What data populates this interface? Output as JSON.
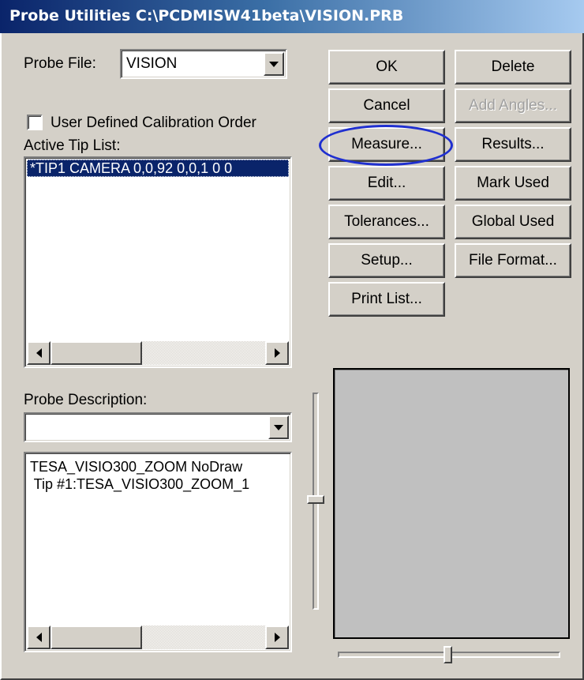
{
  "window": {
    "title": "Probe Utilities  C:\\PCDMISW41beta\\VISION.PRB"
  },
  "probe_file": {
    "label": "Probe File:",
    "value": "VISION"
  },
  "calibration": {
    "checkbox_label": "User Defined Calibration Order",
    "checked": false
  },
  "active_tip_list": {
    "label": "Active Tip List:",
    "items": [
      "*TIP1 CAMERA 0,0,92  0,0,1  0  0"
    ]
  },
  "probe_description": {
    "label": "Probe Description:",
    "value": "",
    "lines": [
      "TESA_VISIO300_ZOOM  NoDraw",
      " Tip #1:TESA_VISIO300_ZOOM_1"
    ]
  },
  "buttons": {
    "ok": "OK",
    "delete": "Delete",
    "cancel": "Cancel",
    "add_angles": "Add Angles...",
    "measure": "Measure...",
    "results": "Results...",
    "edit": "Edit...",
    "mark_used": "Mark Used",
    "tolerances": "Tolerances...",
    "global_used": "Global Used",
    "setup": "Setup...",
    "file_format": "File Format...",
    "print_list": "Print List..."
  },
  "sliders": {
    "vertical_position": 0.49,
    "horizontal_position": 0.5
  },
  "colors": {
    "title_bar_start": "#0a246a",
    "title_bar_end": "#a6caf0",
    "dialog_face": "#d4d0c8",
    "selection": "#0a246a",
    "highlight_ellipse": "#1f2fd0",
    "preview": "#c0c0c0"
  },
  "icons": {
    "dropdown": "chevron-down-icon",
    "scroll_left": "arrow-left-icon",
    "scroll_right": "arrow-right-icon"
  }
}
